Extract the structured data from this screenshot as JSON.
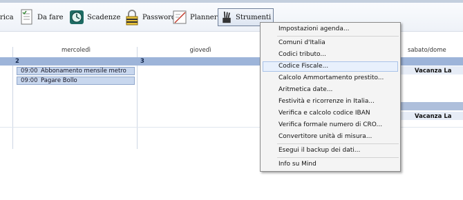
{
  "toolbar": {
    "partial_label": "rica",
    "items": [
      {
        "label": "Da fare",
        "icon": "todo-list-icon"
      },
      {
        "label": "Scadenze",
        "icon": "clock-icon"
      },
      {
        "label": "Password",
        "icon": "padlock-icon"
      },
      {
        "label": "Planner",
        "icon": "planner-icon"
      },
      {
        "label": "Strumenti",
        "icon": "tools-icon"
      }
    ]
  },
  "calendar": {
    "days": [
      "mercoledì",
      "giovedì",
      "sabato/dome"
    ],
    "day_numbers": [
      "2",
      "3"
    ],
    "events": [
      {
        "time": "09:00",
        "title": "Abbonamento mensile metro"
      },
      {
        "time": "09:00",
        "title": "Pagare Bollo"
      }
    ],
    "holidays": [
      "Vacanza La",
      "Vacanza La"
    ]
  },
  "menu": {
    "items": [
      "Impostazioni agenda...",
      "Comuni d'Italia",
      "Codici tributo...",
      "Codice Fiscale...",
      "Calcolo Ammortamento prestito...",
      "Aritmetica date...",
      "Festività e ricorrenze in Italia...",
      "Verifica e calcolo codice IBAN",
      "Verifica formale numero di CRO...",
      "Convertitore unità di misura...",
      "Esegui il backup dei dati...",
      "Info su Mind"
    ],
    "highlighted": "Codice Fiscale..."
  }
}
